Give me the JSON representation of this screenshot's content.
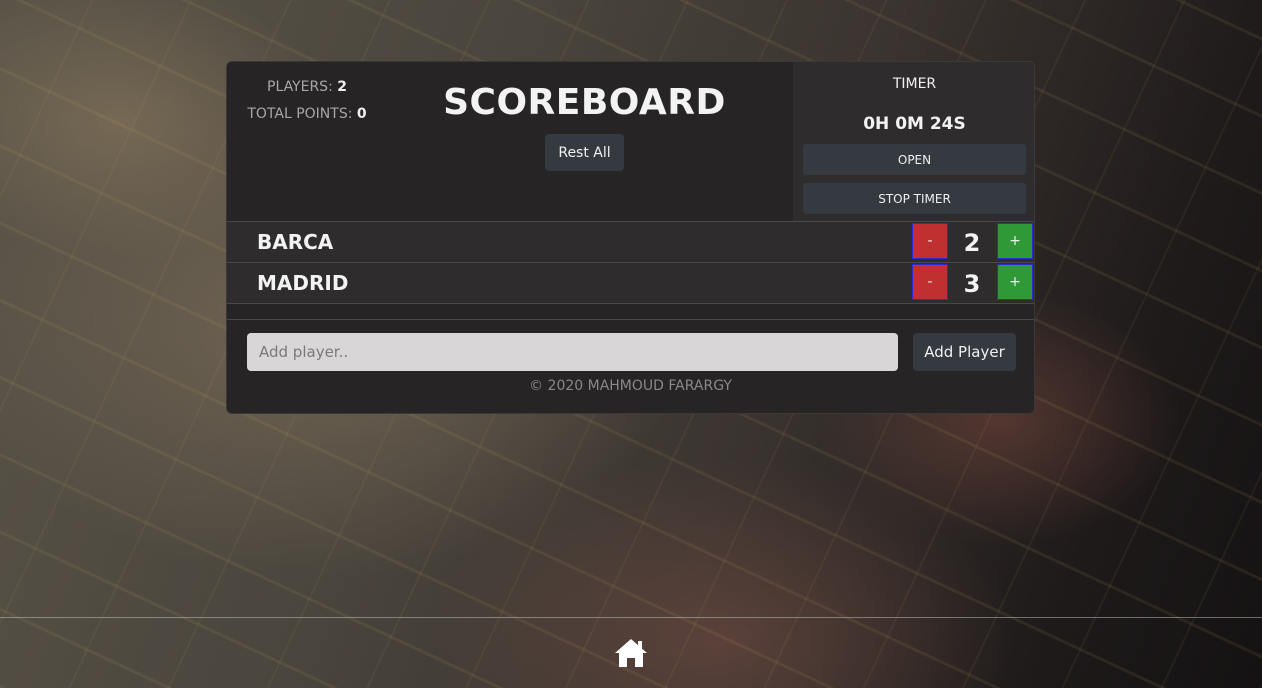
{
  "stats": {
    "players_label": "PLAYERS:",
    "players_value": "2",
    "total_label": "TOTAL POINTS:",
    "total_value": "0"
  },
  "title": "SCOREBOARD",
  "reset_label": "Rest All",
  "timer": {
    "label": "TIMER",
    "value": "0H 0M 24S",
    "open_label": "OPEN",
    "stop_label": "STOP TIMER"
  },
  "players": [
    {
      "name": "BARCA",
      "score": "2",
      "minus": "-",
      "plus": "+"
    },
    {
      "name": "MADRID",
      "score": "3",
      "minus": "-",
      "plus": "+"
    }
  ],
  "add_player": {
    "placeholder": "Add player..",
    "button_label": "Add Player"
  },
  "copyright": "© 2020 MAHMOUD FARARGY",
  "colors": {
    "panel": "#262425",
    "minus_button": "#c03030",
    "plus_button": "#2f9a35",
    "button_dark": "#343a40"
  },
  "icons": {
    "home": "home-icon"
  }
}
